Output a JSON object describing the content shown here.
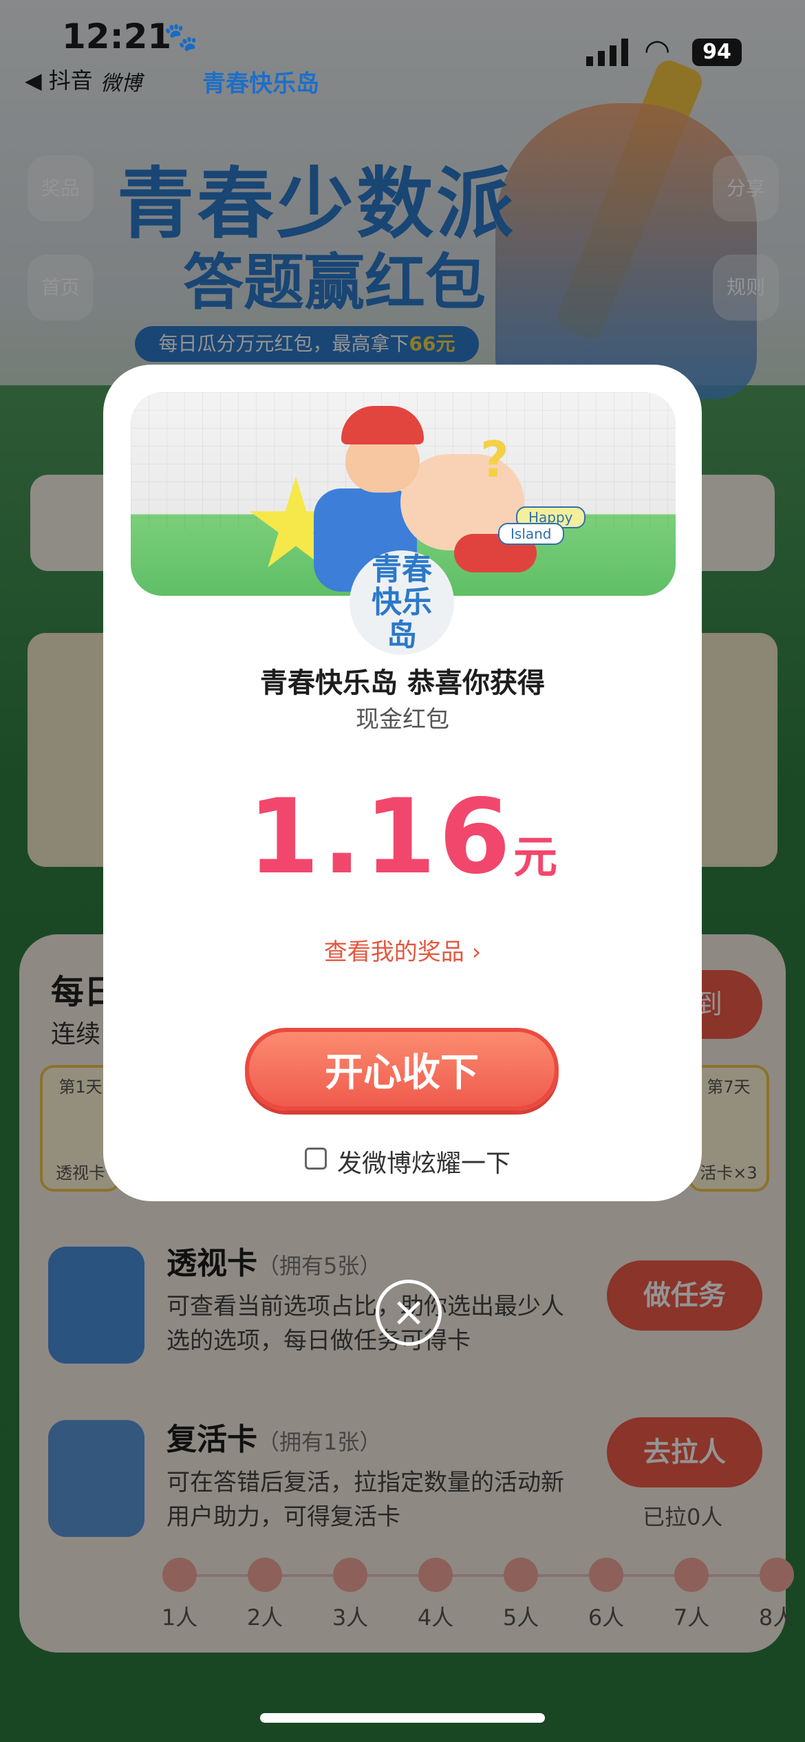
{
  "status_bar": {
    "time": "12:21",
    "back_app": "◀ 抖音",
    "weibo": "微博",
    "app_title": "青春快乐岛",
    "battery": "94"
  },
  "side_buttons": {
    "prizes": "奖品",
    "home": "首页",
    "share": "分享",
    "rules": "规则"
  },
  "banner": {
    "title": "青春少数派",
    "subtitle": "答题赢红包",
    "strip_prefix": "每日瓜分万元红包，最高拿下",
    "strip_highlight": "66元"
  },
  "daily_panel": {
    "title": "每日",
    "subtitle": "连续",
    "checkin_label": "到",
    "day1_label": "第1天",
    "day1_item": "透视卡",
    "day7_label": "第7天",
    "day7_item": "活卡×3"
  },
  "tasks": [
    {
      "name": "透视卡",
      "count": "（拥有5张）",
      "desc": "可查看当前选项占比，助你选出最少人选的选项，每日做任务可得卡",
      "button": "做任务"
    },
    {
      "name": "复活卡",
      "count": "（拥有1张）",
      "desc": "可在答错后复活，拉指定数量的活动新用户助力，可得复活卡",
      "button": "去拉人",
      "note": "已拉0人"
    }
  ],
  "invite_progress": [
    "1人",
    "2人",
    "3人",
    "4人",
    "5人",
    "6人",
    "7人",
    "8人"
  ],
  "modal": {
    "banner_happy": "Happy",
    "banner_island": "Island",
    "logo_text": "青春快乐岛",
    "heading": "青春快乐岛 恭喜你获得",
    "subheading": "现金红包",
    "amount": "1.16",
    "unit": "元",
    "view_prizes": "查看我的奖品 ›",
    "accept_button": "开心收下",
    "share_label": "发微博炫耀一下"
  },
  "colors": {
    "accent": "#f2476c",
    "button": "#f05b4d",
    "brand_blue": "#2b79c9"
  }
}
